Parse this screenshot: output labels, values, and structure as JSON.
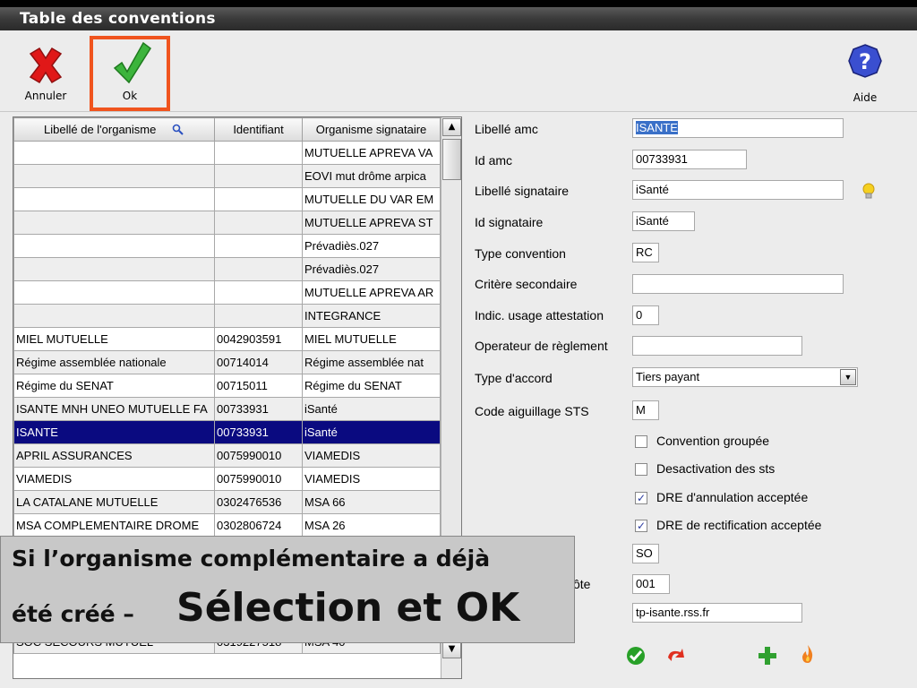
{
  "window": {
    "title": "Table des conventions"
  },
  "toolbar": {
    "cancel_label": "Annuler",
    "ok_label": "Ok",
    "help_label": "Aide",
    "icons": {
      "cancel": "red-x-icon",
      "ok": "green-check-icon",
      "help": "blue-question-icon"
    }
  },
  "grid": {
    "columns": [
      "Libellé de l'organisme",
      "Identifiant",
      "Organisme signataire"
    ],
    "rows": [
      [
        "",
        "",
        "MUTUELLE APREVA VA"
      ],
      [
        "",
        "",
        "EOVI mut drôme arpica"
      ],
      [
        "",
        "",
        "MUTUELLE DU VAR EM"
      ],
      [
        "",
        "",
        "MUTUELLE APREVA ST"
      ],
      [
        "",
        "",
        "Prévadiès.027"
      ],
      [
        "",
        "",
        "Prévadiès.027"
      ],
      [
        "",
        "",
        "MUTUELLE APREVA AR"
      ],
      [
        "",
        "",
        "INTEGRANCE"
      ],
      [
        "MIEL MUTUELLE",
        "0042903591",
        "MIEL MUTUELLE"
      ],
      [
        "Régime assemblée nationale",
        "00714014",
        "Régime assemblée nat"
      ],
      [
        "Régime du SENAT",
        "00715011",
        "Régime du SENAT"
      ],
      [
        "ISANTE MNH UNEO MUTUELLE FA",
        "00733931",
        "iSanté"
      ],
      [
        "ISANTE",
        "00733931",
        "iSanté"
      ],
      [
        "APRIL ASSURANCES",
        "0075990010",
        "VIAMEDIS"
      ],
      [
        "VIAMEDIS",
        "0075990010",
        "VIAMEDIS"
      ],
      [
        "LA CATALANE MUTUELLE",
        "0302476536",
        "MSA 66"
      ],
      [
        "MSA COMPLEMENTAIRE DROME",
        "0302806724",
        "MSA 26"
      ],
      [
        "",
        "",
        ""
      ],
      [
        "",
        "",
        ""
      ],
      [
        "",
        "",
        ""
      ],
      [
        "",
        "",
        ""
      ],
      [
        "SOC SECOURS MUTUEL",
        "0319227518",
        "MSA 40"
      ]
    ],
    "selected_row": 12
  },
  "form": {
    "libelle_amc": {
      "label": "Libellé amc",
      "value": "ISANTE"
    },
    "id_amc": {
      "label": "Id amc",
      "value": "00733931"
    },
    "libelle_signataire": {
      "label": "Libellé signataire",
      "value": "iSanté"
    },
    "id_signataire": {
      "label": "Id signataire",
      "value": "iSanté"
    },
    "type_convention": {
      "label": "Type convention",
      "value": "RC"
    },
    "critere_secondaire": {
      "label": "Critère secondaire",
      "value": ""
    },
    "indic_usage": {
      "label": "Indic. usage attestation",
      "value": "0"
    },
    "operateur": {
      "label": "Operateur de règlement",
      "value": ""
    },
    "type_accord": {
      "label": "Type d'accord",
      "value": "Tiers payant"
    },
    "code_aiguillage": {
      "label": "Code aiguillage STS",
      "value": "M"
    },
    "checkboxes": [
      {
        "label": "Convention groupée",
        "checked": false
      },
      {
        "label": "Desactivation des sts",
        "checked": false
      },
      {
        "label": "DRE d'annulation acceptée",
        "checked": true
      },
      {
        "label": "DRE de rectification acceptée",
        "checked": true
      }
    ],
    "hidden_label_fragment": "ôte",
    "field_so": "SO",
    "field_001": "001",
    "field_host": "tp-isante.rss.fr"
  },
  "overlay": {
    "line1": "Si l’organisme complémentaire a déjà",
    "line2_prefix": "été créé –",
    "line2_big": "Sélection et OK"
  },
  "colors": {
    "selection": "#0a0a80",
    "ok_highlight": "#f0541e"
  }
}
